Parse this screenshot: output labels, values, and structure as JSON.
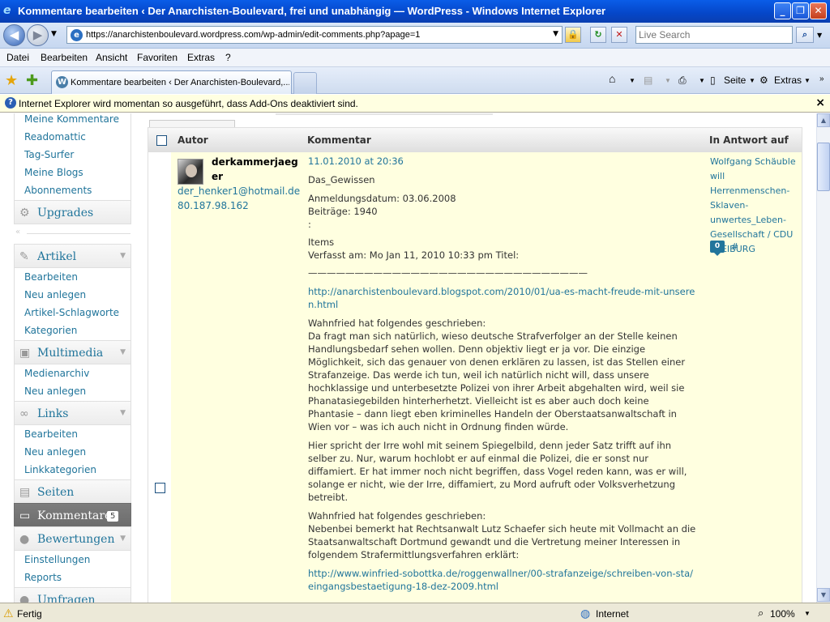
{
  "window": {
    "title": "Kommentare bearbeiten ‹ Der Anarchisten-Boulevard, frei und unabhängig — WordPress - Windows Internet Explorer",
    "minimize": "_",
    "maximize": "❐",
    "close": "✕"
  },
  "address": {
    "url": "https://anarchistenboulevard.wordpress.com/wp-admin/edit-comments.php?apage=1",
    "search_placeholder": "Live Search"
  },
  "menu": [
    "Datei",
    "Bearbeiten",
    "Ansicht",
    "Favoriten",
    "Extras",
    "?"
  ],
  "tabs": {
    "active_label": "Kommentare bearbeiten ‹ Der Anarchisten-Boulevard,...",
    "seite": "Seite",
    "extras": "Extras"
  },
  "infobar": {
    "message": "Internet Explorer wird momentan so ausgeführt, dass Add-Ons deaktiviert sind."
  },
  "sidebar": {
    "top_items": [
      "Meine Kommentare",
      "Readomattic",
      "Tag-Surfer",
      "Meine Blogs",
      "Abonnements"
    ],
    "upgrades": "Upgrades",
    "artikel": {
      "label": "Artikel",
      "items": [
        "Bearbeiten",
        "Neu anlegen",
        "Artikel-Schlagworte",
        "Kategorien"
      ]
    },
    "multimedia": {
      "label": "Multimedia",
      "items": [
        "Medienarchiv",
        "Neu anlegen"
      ]
    },
    "links": {
      "label": "Links",
      "items": [
        "Bearbeiten",
        "Neu anlegen",
        "Linkkategorien"
      ]
    },
    "seiten": "Seiten",
    "kommentare": {
      "label": "Kommentare",
      "count": "5"
    },
    "bewertungen": {
      "label": "Bewertungen",
      "items": [
        "Einstellungen",
        "Reports"
      ]
    },
    "umfragen": "Umfragen"
  },
  "table": {
    "col_author": "Autor",
    "col_comment": "Kommentar",
    "col_reply": "In Antwort auf"
  },
  "comment": {
    "author": "derkammerjaeger",
    "email": "der_henker1@hotmail.de",
    "ip": "80.187.98.162",
    "date": "11.01.2010 at 20:36",
    "p1": "Das_Gewissen",
    "p2a": "Anmeldungsdatum: 03.06.2008",
    "p2b": "Beiträge: 1940",
    "p2c": ":",
    "p3a": "Items",
    "p3b": "Verfasst am: Mo Jan 11, 2010 10:33 pm Titel:",
    "p3c": "——————————————————————————————",
    "link1": "http://anarchistenboulevard.blogspot.com/2010/01/ua-es-macht-freude-mit-unseren.html",
    "p4a": "Wahnfried hat folgendes geschrieben:",
    "p4b": "Da fragt man sich natürlich, wieso deutsche Strafverfolger an der Stelle keinen Handlungsbedarf sehen wollen. Denn objektiv liegt er ja vor. Die einzige Möglichkeit, sich das genauer von denen erklären zu lassen, ist das Stellen einer Strafanzeige. Das werde ich tun, weil ich natürlich nicht will, dass unsere hochklassige und unterbesetzte Polizei von ihrer Arbeit abgehalten wird, weil sie Phanatasiegebilden hinterherhetzt. Vielleicht ist es aber auch doch keine Phantasie – dann liegt eben kriminelles Handeln der Oberstaatsanwaltschaft in Wien vor – was ich auch nicht in Ordnung finden würde.",
    "p5": "Hier spricht der Irre wohl mit seinem Spiegelbild, denn jeder Satz trifft auf ihn selber zu. Nur, warum hochlobt er auf einmal die Polizei, die er sonst nur diffamiert. Er hat immer noch nicht begriffen, dass Vogel reden kann, was er will, solange er nicht, wie der Irre, diffamiert, zu Mord aufruft oder Volksverhetzung betreibt.",
    "p6a": "Wahnfried hat folgendes geschrieben:",
    "p6b": "Nebenbei bemerkt hat Rechtsanwalt Lutz Schaefer sich heute mit Vollmacht an die Staatsanwaltschaft Dortmund gewandt und die Vertretung meiner Interessen in folgendem Strafermittlungsverfahren erklärt:",
    "link2": "http://www.winfried-sobottka.de/roggenwallner/00-strafanzeige/schreiben-von-sta/eingangsbestaetigung-18-dez-2009.html",
    "reply_to": "Wolfgang Schäuble will Herrenmenschen-Sklaven-unwertes_Leben-Gesellschaft / CDU FREIBURG",
    "reply_count": "0",
    "hash": "#"
  },
  "status": {
    "left": "Fertig",
    "zone": "Internet",
    "zoom": "100%"
  }
}
